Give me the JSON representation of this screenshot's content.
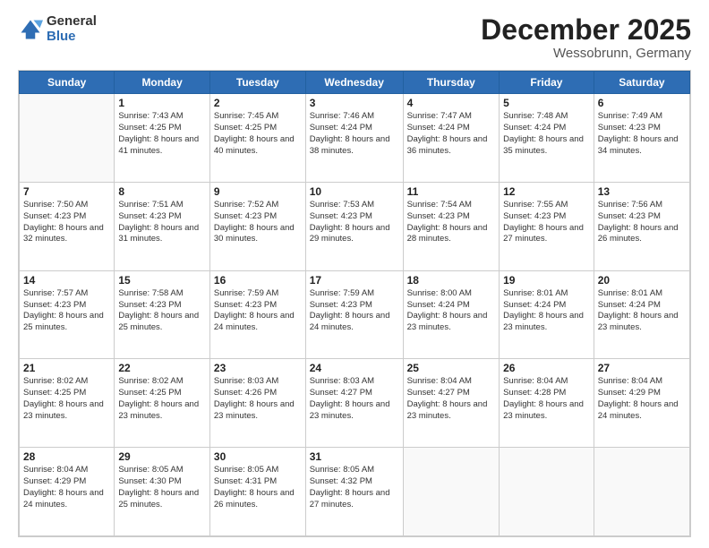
{
  "logo": {
    "general": "General",
    "blue": "Blue"
  },
  "title": {
    "month": "December 2025",
    "location": "Wessobrunn, Germany"
  },
  "headers": [
    "Sunday",
    "Monday",
    "Tuesday",
    "Wednesday",
    "Thursday",
    "Friday",
    "Saturday"
  ],
  "weeks": [
    [
      {
        "day": "",
        "sunrise": "",
        "sunset": "",
        "daylight": ""
      },
      {
        "day": "1",
        "sunrise": "Sunrise: 7:43 AM",
        "sunset": "Sunset: 4:25 PM",
        "daylight": "Daylight: 8 hours and 41 minutes."
      },
      {
        "day": "2",
        "sunrise": "Sunrise: 7:45 AM",
        "sunset": "Sunset: 4:25 PM",
        "daylight": "Daylight: 8 hours and 40 minutes."
      },
      {
        "day": "3",
        "sunrise": "Sunrise: 7:46 AM",
        "sunset": "Sunset: 4:24 PM",
        "daylight": "Daylight: 8 hours and 38 minutes."
      },
      {
        "day": "4",
        "sunrise": "Sunrise: 7:47 AM",
        "sunset": "Sunset: 4:24 PM",
        "daylight": "Daylight: 8 hours and 36 minutes."
      },
      {
        "day": "5",
        "sunrise": "Sunrise: 7:48 AM",
        "sunset": "Sunset: 4:24 PM",
        "daylight": "Daylight: 8 hours and 35 minutes."
      },
      {
        "day": "6",
        "sunrise": "Sunrise: 7:49 AM",
        "sunset": "Sunset: 4:23 PM",
        "daylight": "Daylight: 8 hours and 34 minutes."
      }
    ],
    [
      {
        "day": "7",
        "sunrise": "Sunrise: 7:50 AM",
        "sunset": "Sunset: 4:23 PM",
        "daylight": "Daylight: 8 hours and 32 minutes."
      },
      {
        "day": "8",
        "sunrise": "Sunrise: 7:51 AM",
        "sunset": "Sunset: 4:23 PM",
        "daylight": "Daylight: 8 hours and 31 minutes."
      },
      {
        "day": "9",
        "sunrise": "Sunrise: 7:52 AM",
        "sunset": "Sunset: 4:23 PM",
        "daylight": "Daylight: 8 hours and 30 minutes."
      },
      {
        "day": "10",
        "sunrise": "Sunrise: 7:53 AM",
        "sunset": "Sunset: 4:23 PM",
        "daylight": "Daylight: 8 hours and 29 minutes."
      },
      {
        "day": "11",
        "sunrise": "Sunrise: 7:54 AM",
        "sunset": "Sunset: 4:23 PM",
        "daylight": "Daylight: 8 hours and 28 minutes."
      },
      {
        "day": "12",
        "sunrise": "Sunrise: 7:55 AM",
        "sunset": "Sunset: 4:23 PM",
        "daylight": "Daylight: 8 hours and 27 minutes."
      },
      {
        "day": "13",
        "sunrise": "Sunrise: 7:56 AM",
        "sunset": "Sunset: 4:23 PM",
        "daylight": "Daylight: 8 hours and 26 minutes."
      }
    ],
    [
      {
        "day": "14",
        "sunrise": "Sunrise: 7:57 AM",
        "sunset": "Sunset: 4:23 PM",
        "daylight": "Daylight: 8 hours and 25 minutes."
      },
      {
        "day": "15",
        "sunrise": "Sunrise: 7:58 AM",
        "sunset": "Sunset: 4:23 PM",
        "daylight": "Daylight: 8 hours and 25 minutes."
      },
      {
        "day": "16",
        "sunrise": "Sunrise: 7:59 AM",
        "sunset": "Sunset: 4:23 PM",
        "daylight": "Daylight: 8 hours and 24 minutes."
      },
      {
        "day": "17",
        "sunrise": "Sunrise: 7:59 AM",
        "sunset": "Sunset: 4:23 PM",
        "daylight": "Daylight: 8 hours and 24 minutes."
      },
      {
        "day": "18",
        "sunrise": "Sunrise: 8:00 AM",
        "sunset": "Sunset: 4:24 PM",
        "daylight": "Daylight: 8 hours and 23 minutes."
      },
      {
        "day": "19",
        "sunrise": "Sunrise: 8:01 AM",
        "sunset": "Sunset: 4:24 PM",
        "daylight": "Daylight: 8 hours and 23 minutes."
      },
      {
        "day": "20",
        "sunrise": "Sunrise: 8:01 AM",
        "sunset": "Sunset: 4:24 PM",
        "daylight": "Daylight: 8 hours and 23 minutes."
      }
    ],
    [
      {
        "day": "21",
        "sunrise": "Sunrise: 8:02 AM",
        "sunset": "Sunset: 4:25 PM",
        "daylight": "Daylight: 8 hours and 23 minutes."
      },
      {
        "day": "22",
        "sunrise": "Sunrise: 8:02 AM",
        "sunset": "Sunset: 4:25 PM",
        "daylight": "Daylight: 8 hours and 23 minutes."
      },
      {
        "day": "23",
        "sunrise": "Sunrise: 8:03 AM",
        "sunset": "Sunset: 4:26 PM",
        "daylight": "Daylight: 8 hours and 23 minutes."
      },
      {
        "day": "24",
        "sunrise": "Sunrise: 8:03 AM",
        "sunset": "Sunset: 4:27 PM",
        "daylight": "Daylight: 8 hours and 23 minutes."
      },
      {
        "day": "25",
        "sunrise": "Sunrise: 8:04 AM",
        "sunset": "Sunset: 4:27 PM",
        "daylight": "Daylight: 8 hours and 23 minutes."
      },
      {
        "day": "26",
        "sunrise": "Sunrise: 8:04 AM",
        "sunset": "Sunset: 4:28 PM",
        "daylight": "Daylight: 8 hours and 23 minutes."
      },
      {
        "day": "27",
        "sunrise": "Sunrise: 8:04 AM",
        "sunset": "Sunset: 4:29 PM",
        "daylight": "Daylight: 8 hours and 24 minutes."
      }
    ],
    [
      {
        "day": "28",
        "sunrise": "Sunrise: 8:04 AM",
        "sunset": "Sunset: 4:29 PM",
        "daylight": "Daylight: 8 hours and 24 minutes."
      },
      {
        "day": "29",
        "sunrise": "Sunrise: 8:05 AM",
        "sunset": "Sunset: 4:30 PM",
        "daylight": "Daylight: 8 hours and 25 minutes."
      },
      {
        "day": "30",
        "sunrise": "Sunrise: 8:05 AM",
        "sunset": "Sunset: 4:31 PM",
        "daylight": "Daylight: 8 hours and 26 minutes."
      },
      {
        "day": "31",
        "sunrise": "Sunrise: 8:05 AM",
        "sunset": "Sunset: 4:32 PM",
        "daylight": "Daylight: 8 hours and 27 minutes."
      },
      {
        "day": "",
        "sunrise": "",
        "sunset": "",
        "daylight": ""
      },
      {
        "day": "",
        "sunrise": "",
        "sunset": "",
        "daylight": ""
      },
      {
        "day": "",
        "sunrise": "",
        "sunset": "",
        "daylight": ""
      }
    ]
  ]
}
